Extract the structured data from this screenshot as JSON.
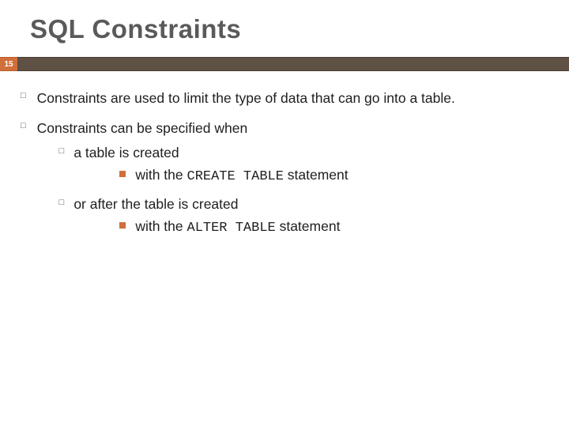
{
  "title": "SQL Constraints",
  "page_number": "15",
  "bullet1_glyph": "□",
  "bullet2_glyph": "□",
  "bullet3_glyph": "",
  "items": {
    "p1": "Constraints are used to limit the type of data that can go into a table.",
    "p2": "Constraints can be specified when",
    "p2a": "a table is created",
    "p2a1_pre": "with the ",
    "p2a1_code": "CREATE TABLE",
    "p2a1_post": "  statement",
    "p2b": "or after the table is created",
    "p2b1_pre": "with the ",
    "p2b1_code": "ALTER TABLE",
    "p2b1_post": "  statement"
  }
}
